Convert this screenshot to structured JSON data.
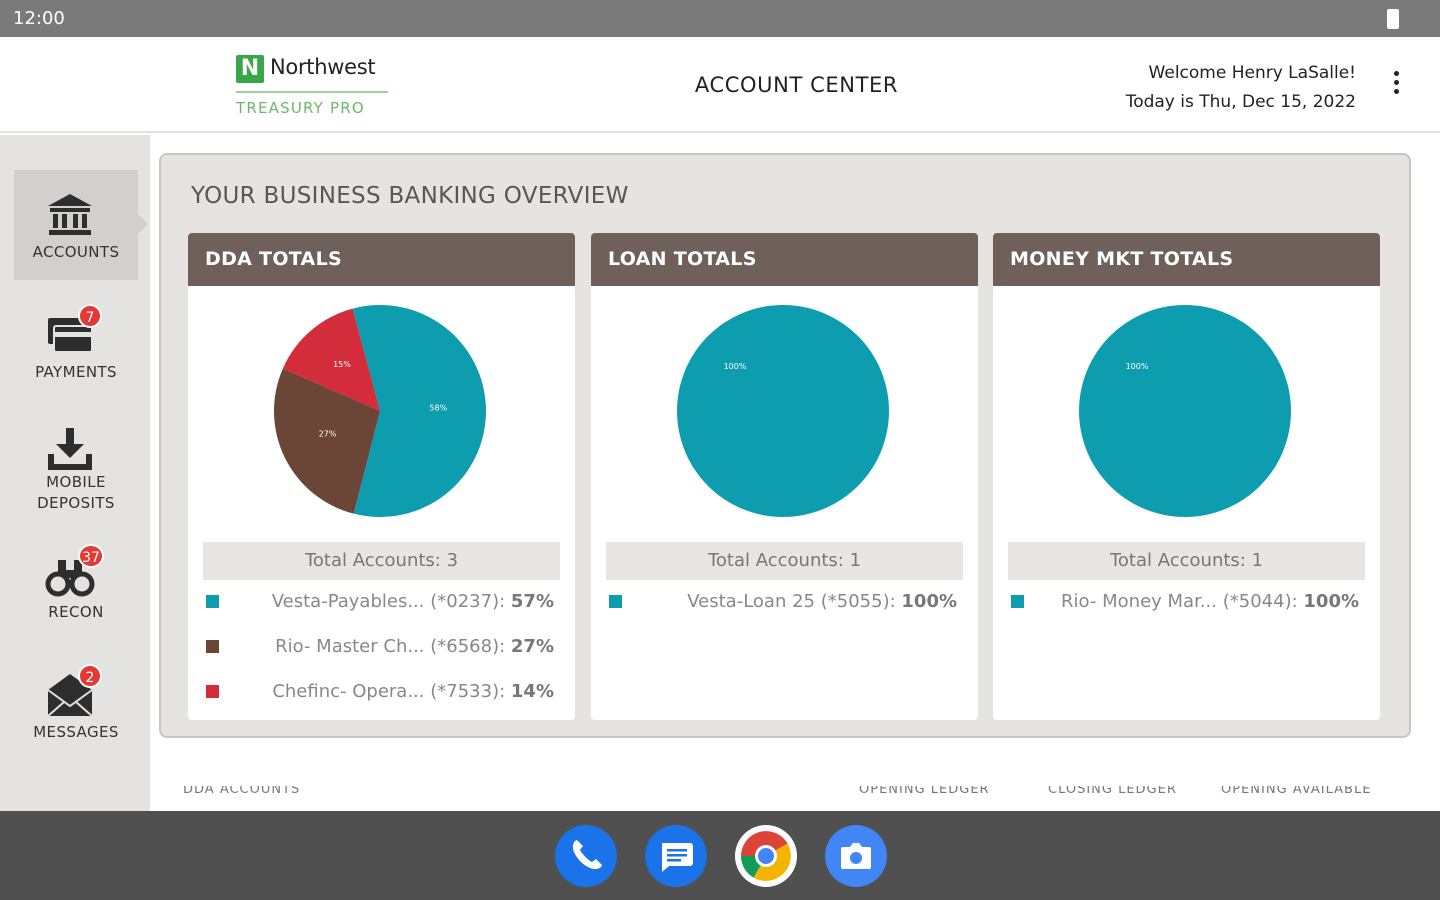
{
  "status_bar": {
    "time": "12:00"
  },
  "header": {
    "logo_badge": "N",
    "logo_name": "Northwest",
    "logo_sub": "TREASURY PRO",
    "title": "ACCOUNT CENTER",
    "welcome": "Welcome Henry LaSalle!",
    "date": "Today is Thu, Dec 15, 2022",
    "menu_icon": "more-vert-icon"
  },
  "sidebar": {
    "items": [
      {
        "label": "ACCOUNTS",
        "icon": "bank-icon",
        "active": true,
        "badge": ""
      },
      {
        "label": "PAYMENTS",
        "icon": "card-icon",
        "active": false,
        "badge": "7"
      },
      {
        "label": "MOBILE",
        "label2": "DEPOSITS",
        "icon": "download-icon",
        "active": false,
        "badge": ""
      },
      {
        "label": "RECON",
        "icon": "binoculars-icon",
        "active": false,
        "badge": "37"
      },
      {
        "label": "MESSAGES",
        "icon": "mail-icon",
        "active": false,
        "badge": "2"
      }
    ]
  },
  "overview": {
    "title": "YOUR BUSINESS BANKING OVERVIEW",
    "cards": [
      {
        "title": "DDA TOTALS",
        "total_label": "Total Accounts: 3",
        "rows": [
          {
            "name": "Vesta-Payables...",
            "acct": "(*0237):",
            "pct": "57%",
            "color": "#0e9caf"
          },
          {
            "name": "Rio- Master Ch...",
            "acct": "(*6568):",
            "pct": "27%",
            "color": "#6b4535"
          },
          {
            "name": "Chefinc- Opera...",
            "acct": "(*7533):",
            "pct": "14%",
            "color": "#d32c3a"
          }
        ]
      },
      {
        "title": "LOAN TOTALS",
        "total_label": "Total Accounts: 1",
        "rows": [
          {
            "name": "Vesta-Loan 25",
            "acct": "(*5055):",
            "pct": "100%",
            "color": "#0e9caf"
          }
        ]
      },
      {
        "title": "MONEY MKT TOTALS",
        "total_label": "Total Accounts: 1",
        "rows": [
          {
            "name": "Rio- Money Mar...",
            "acct": "(*5044):",
            "pct": "100%",
            "color": "#0e9caf"
          }
        ]
      }
    ]
  },
  "chart_data": [
    {
      "type": "pie",
      "title": "DDA TOTALS",
      "categories": [
        "Vesta-Payables... (*0237)",
        "Rio- Master Ch... (*6568)",
        "Chefinc- Opera... (*7533)"
      ],
      "values": [
        57,
        27,
        14
      ],
      "colors": [
        "#0e9caf",
        "#6b4535",
        "#d32c3a"
      ],
      "slice_labels": [
        "58%",
        "27%",
        "15%"
      ]
    },
    {
      "type": "pie",
      "title": "LOAN TOTALS",
      "categories": [
        "Vesta-Loan 25 (*5055)"
      ],
      "values": [
        100
      ],
      "colors": [
        "#0e9caf"
      ],
      "slice_labels": [
        "100%"
      ]
    },
    {
      "type": "pie",
      "title": "MONEY MKT TOTALS",
      "categories": [
        "Rio- Money Mar... (*5044)"
      ],
      "values": [
        100
      ],
      "colors": [
        "#0e9caf"
      ],
      "slice_labels": [
        "100%"
      ]
    }
  ],
  "table_peek": {
    "col1": "DDA ACCOUNTS",
    "col2": "OPENING LEDGER",
    "col3": "CLOSING LEDGER",
    "col4": "OPENING AVAILABLE"
  },
  "dock": {
    "apps": [
      {
        "name": "phone-app",
        "color": "#1a73e8"
      },
      {
        "name": "messages-app",
        "color": "#1a73e8"
      },
      {
        "name": "chrome-app",
        "color": "#ffffff"
      },
      {
        "name": "camera-app",
        "color": "#4285f4"
      }
    ]
  }
}
